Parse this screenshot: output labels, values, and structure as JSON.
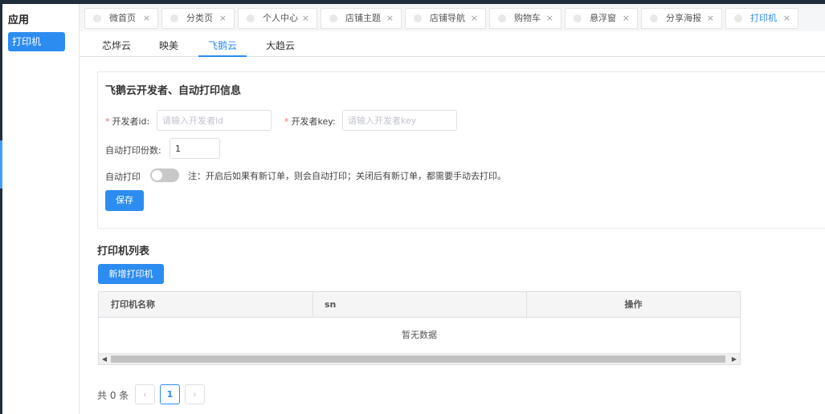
{
  "sidebar": {
    "title": "应用",
    "items": [
      {
        "label": "打印机",
        "active": true
      }
    ]
  },
  "tabs": [
    {
      "label": "微首页",
      "active": false
    },
    {
      "label": "分类页",
      "active": false
    },
    {
      "label": "个人中心",
      "active": false
    },
    {
      "label": "店铺主题",
      "active": false
    },
    {
      "label": "店铺导航",
      "active": false
    },
    {
      "label": "购物车",
      "active": false
    },
    {
      "label": "悬浮窗",
      "active": false
    },
    {
      "label": "分享海报",
      "active": false
    },
    {
      "label": "打印机",
      "active": true
    }
  ],
  "tab_close_symbol": "×",
  "subtabs": [
    {
      "label": "芯烨云",
      "active": false
    },
    {
      "label": "映美",
      "active": false
    },
    {
      "label": "飞鹅云",
      "active": true
    },
    {
      "label": "大趋云",
      "active": false
    }
  ],
  "form": {
    "title": "飞鹅云开发者、自动打印信息",
    "required_mark": "*",
    "dev_id": {
      "label": "开发者id:",
      "placeholder": "请输入开发者id",
      "value": ""
    },
    "dev_key": {
      "label": "开发者key:",
      "placeholder": "请输入开发者key",
      "value": ""
    },
    "copies": {
      "label": "自动打印份数:",
      "value": "1"
    },
    "auto_print": {
      "label": "自动打印",
      "enabled": false
    },
    "note": "注：开启后如果有新订单，则会自动打印；关闭后有新订单，都需要手动去打印。",
    "save_label": "保存"
  },
  "printer_list": {
    "title": "打印机列表",
    "add_label": "新增打印机",
    "columns": [
      "打印机名称",
      "sn",
      "操作"
    ],
    "rows": [],
    "empty_text": "暂无数据"
  },
  "pagination": {
    "total_text": "共 0 条",
    "current_page": "1",
    "prev": "‹",
    "next": "›"
  },
  "scroll": {
    "left": "◀",
    "right": "▶"
  },
  "colors": {
    "primary": "#2d8cf0",
    "required": "#f56c6c",
    "dark_frame": "#1f2d3d"
  }
}
